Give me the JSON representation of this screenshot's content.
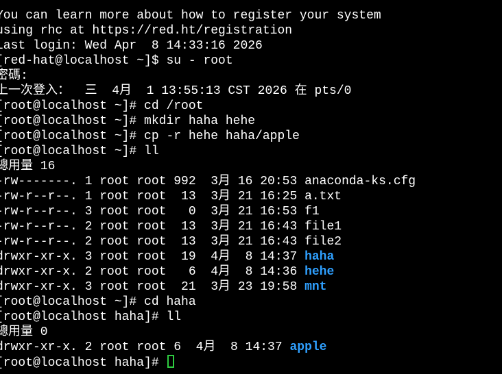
{
  "terminal": {
    "lines": [
      "You can learn more about how to register your system",
      "using rhc at https://red.ht/registration",
      "Last login: Wed Apr  8 14:33:16 2026",
      "[red-hat@localhost ~]$ su - root",
      "密碼:",
      "上一次登入：  三  4月  1 13:55:13 CST 2026 在 pts/0",
      "[root@localhost ~]# cd /root",
      "[root@localhost ~]# mkdir haha hehe",
      "[root@localhost ~]# cp -r hehe haha/apple",
      "[root@localhost ~]# ll",
      "總用量 16",
      "-rw-------. 1 root root 992  3月 16 20:53 anaconda-ks.cfg",
      "-rw-r--r--. 1 root root  13  3月 21 16:25 a.txt",
      "-rw-r--r--. 3 root root   0  3月 21 16:53 f1",
      "-rw-r--r--. 2 root root  13  3月 21 16:43 file1",
      "-rw-r--r--. 2 root root  13  3月 21 16:43 file2"
    ],
    "ls_dir_prefixes": [
      "drwxr-xr-x. 3 root root  19  4月  8 14:37 ",
      "drwxr-xr-x. 2 root root   6  4月  8 14:36 ",
      "drwxr-xr-x. 3 root root  21  3月 23 19:58 "
    ],
    "ls_dir_names": [
      "haha",
      "hehe",
      "mnt"
    ],
    "after_lines": [
      "[root@localhost ~]# cd haha",
      "[root@localhost haha]# ll",
      "總用量 0"
    ],
    "apple_prefix": "drwxr-xr-x. 2 root root 6  4月  8 14:37 ",
    "apple_name": "apple",
    "prompt": "[root@localhost haha]# ",
    "colors": {
      "background": "#000000",
      "text": "#ffffff",
      "directory": "#2fa0ff",
      "cursor": "#2ecc40"
    }
  }
}
